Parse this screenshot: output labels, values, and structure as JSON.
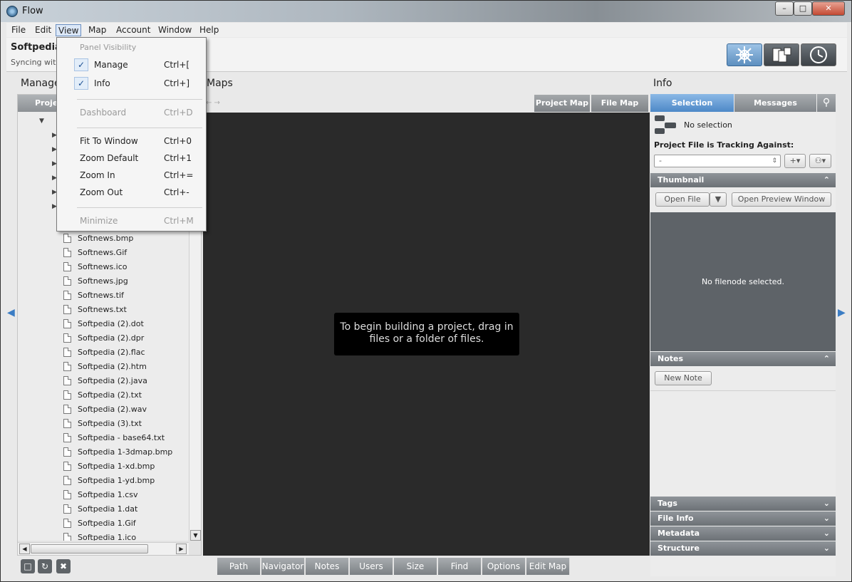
{
  "window": {
    "title": "Flow"
  },
  "menubar": [
    "File",
    "Edit",
    "View",
    "Map",
    "Account",
    "Window",
    "Help"
  ],
  "topbar": {
    "project": "Softpedia",
    "sync": "Syncing with"
  },
  "panels": {
    "manage": "Manage",
    "maps": "Maps",
    "info": "Info"
  },
  "tree": {
    "tab": "Projects",
    "files": [
      "Softnews.bmp",
      "Softnews.Gif",
      "Softnews.ico",
      "Softnews.jpg",
      "Softnews.tif",
      "Softnews.txt",
      "Softpedia (2).dot",
      "Softpedia (2).dpr",
      "Softpedia (2).flac",
      "Softpedia (2).htm",
      "Softpedia (2).java",
      "Softpedia (2).txt",
      "Softpedia (2).wav",
      "Softpedia (3).txt",
      "Softpedia - base64.txt",
      "Softpedia 1-3dmap.bmp",
      "Softpedia 1-xd.bmp",
      "Softpedia 1-yd.bmp",
      "Softpedia 1.csv",
      "Softpedia 1.dat",
      "Softpedia 1.Gif",
      "Softpedia 1.ico"
    ]
  },
  "maps": {
    "tabs": [
      "Project Map",
      "File Map"
    ],
    "hint": "To begin building a project, drag in files or a folder of files.",
    "bottom_tabs": [
      "Path",
      "Navigator",
      "Notes",
      "Users",
      "Size",
      "Find",
      "Options",
      "Edit Map"
    ]
  },
  "info": {
    "tabs": [
      "Selection",
      "Messages"
    ],
    "no_selection": "No selection",
    "tracking_label": "Project File is Tracking Against:",
    "tracking_value": "-",
    "thumbnail": {
      "header": "Thumbnail",
      "open_file": "Open File",
      "open_preview": "Open Preview Window",
      "empty": "No filenode selected."
    },
    "notes": {
      "header": "Notes",
      "new_note": "New Note"
    },
    "sections": [
      "Tags",
      "File Info",
      "Metadata",
      "Structure"
    ]
  },
  "view_menu": {
    "header": "Panel Visibility",
    "items": [
      {
        "label": "Manage",
        "shortcut": "Ctrl+[",
        "checked": true
      },
      {
        "label": "Info",
        "shortcut": "Ctrl+]",
        "checked": true
      },
      {
        "label": "Dashboard",
        "shortcut": "Ctrl+D",
        "disabled": true
      },
      {
        "label": "Fit To Window",
        "shortcut": "Ctrl+0"
      },
      {
        "label": "Zoom Default",
        "shortcut": "Ctrl+1"
      },
      {
        "label": "Zoom In",
        "shortcut": "Ctrl+="
      },
      {
        "label": "Zoom Out",
        "shortcut": "Ctrl+-"
      },
      {
        "label": "Minimize",
        "shortcut": "Ctrl+M",
        "disabled": true
      }
    ]
  },
  "colors": {
    "accent": "#4d88c7",
    "canvas": "#2a2a2a"
  }
}
